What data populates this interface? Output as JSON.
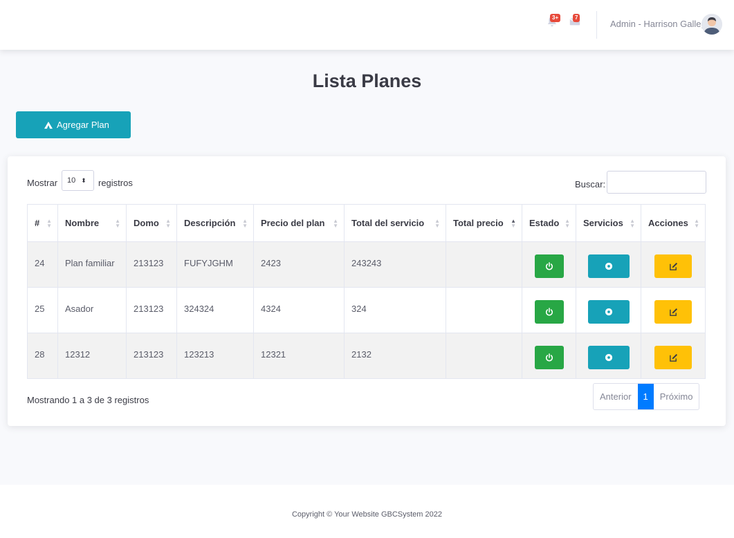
{
  "topbar": {
    "alerts_badge": "3+",
    "messages_badge": "7",
    "user_name": "Admin - Harrison Gallego"
  },
  "page": {
    "title": "Lista Planes",
    "add_button": "Agregar Plan"
  },
  "table_controls": {
    "show_label": "Mostrar",
    "length_value": "10",
    "records_label": "registros",
    "search_label": "Buscar:",
    "search_value": ""
  },
  "table": {
    "columns": [
      "#",
      "Nombre",
      "Domo",
      "Descripción",
      "Precio del plan",
      "Total del servicio",
      "Total precio",
      "Estado",
      "Servicios",
      "Acciones"
    ],
    "rows": [
      {
        "id": "24",
        "nombre": "Plan familiar",
        "domo": "213123",
        "descripcion": "FUFYJGHM",
        "precio": "2423",
        "total_servicio": "243243",
        "total_precio": ""
      },
      {
        "id": "25",
        "nombre": "Asador",
        "domo": "213123",
        "descripcion": "324324",
        "precio": "4324",
        "total_servicio": "324",
        "total_precio": ""
      },
      {
        "id": "28",
        "nombre": "12312",
        "domo": "213123",
        "descripcion": "123213",
        "precio": "12321",
        "total_servicio": "2132",
        "total_precio": ""
      }
    ]
  },
  "footer_info": {
    "showing": "Mostrando 1 a 3 de 3 registros",
    "prev": "Anterior",
    "page": "1",
    "next": "Próximo"
  },
  "footer": {
    "copyright": "Copyright © Your Website GBCSystem 2022"
  },
  "colors": {
    "accent_teal": "#17a2b8",
    "success": "#28a745",
    "warning": "#ffc107",
    "primary": "#007bff",
    "danger": "#e74a3b"
  }
}
